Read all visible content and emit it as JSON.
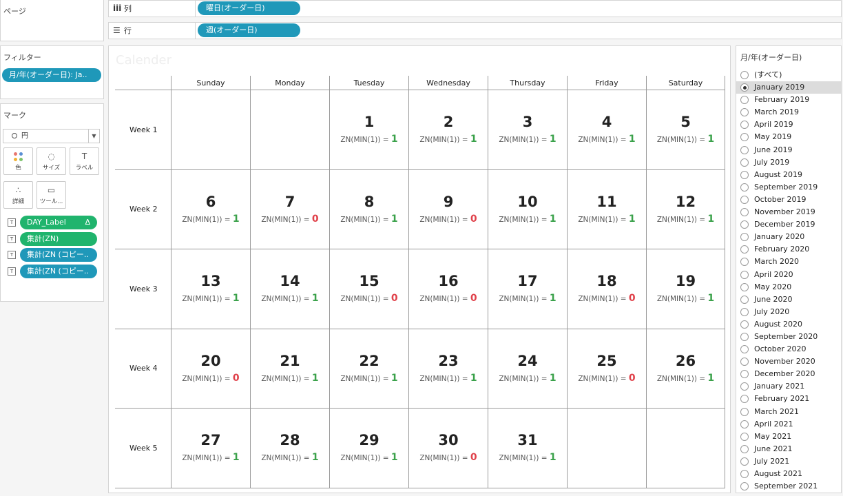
{
  "left": {
    "pages_title": "ページ",
    "filters_title": "フィルター",
    "filter_pill": "月/年(オーダー日): Ja..",
    "marks_title": "マーク",
    "mark_type": "円",
    "mark_buttons": [
      {
        "label": "色",
        "icon": "color-dots-icon"
      },
      {
        "label": "サイズ",
        "icon": "size-icon"
      },
      {
        "label": "ラベル",
        "icon": "label-icon"
      },
      {
        "label": "詳細",
        "icon": "detail-icon"
      },
      {
        "label": "ツール...",
        "icon": "tooltip-icon"
      }
    ],
    "shelf_pills": [
      {
        "label": "DAY_Label",
        "icon_text": "T",
        "color": "#20b46d",
        "suffix": "Δ"
      },
      {
        "label": "集計(ZN)",
        "icon_text": "T",
        "color": "#20b46d",
        "suffix": ""
      },
      {
        "label": "集計(ZN (コピー..",
        "icon_text": "T",
        "color": "#1f98b9",
        "suffix": ""
      },
      {
        "label": "集計(ZN (コピー..",
        "icon_text": "T",
        "color": "#1f98b9",
        "suffix": ""
      }
    ]
  },
  "shelves": {
    "columns_label": "列",
    "columns_pill": "曜日(オーダー日)",
    "rows_label": "行",
    "rows_pill": "週(オーダー日)"
  },
  "sheet": {
    "title": "Calender",
    "days": [
      "Sunday",
      "Monday",
      "Tuesday",
      "Wednesday",
      "Thursday",
      "Friday",
      "Saturday"
    ],
    "weeks": [
      {
        "label": "Week 1",
        "cells": [
          null,
          null,
          {
            "d": "1",
            "v": "1"
          },
          {
            "d": "2",
            "v": "1"
          },
          {
            "d": "3",
            "v": "1"
          },
          {
            "d": "4",
            "v": "1"
          },
          {
            "d": "5",
            "v": "1"
          }
        ]
      },
      {
        "label": "Week 2",
        "cells": [
          {
            "d": "6",
            "v": "1"
          },
          {
            "d": "7",
            "v": "0"
          },
          {
            "d": "8",
            "v": "1"
          },
          {
            "d": "9",
            "v": "0"
          },
          {
            "d": "10",
            "v": "1"
          },
          {
            "d": "11",
            "v": "1"
          },
          {
            "d": "12",
            "v": "1"
          }
        ]
      },
      {
        "label": "Week 3",
        "cells": [
          {
            "d": "13",
            "v": "1"
          },
          {
            "d": "14",
            "v": "1"
          },
          {
            "d": "15",
            "v": "0"
          },
          {
            "d": "16",
            "v": "0"
          },
          {
            "d": "17",
            "v": "1"
          },
          {
            "d": "18",
            "v": "0"
          },
          {
            "d": "19",
            "v": "1"
          }
        ]
      },
      {
        "label": "Week 4",
        "cells": [
          {
            "d": "20",
            "v": "0"
          },
          {
            "d": "21",
            "v": "1"
          },
          {
            "d": "22",
            "v": "1"
          },
          {
            "d": "23",
            "v": "1"
          },
          {
            "d": "24",
            "v": "1"
          },
          {
            "d": "25",
            "v": "0"
          },
          {
            "d": "26",
            "v": "1"
          }
        ]
      },
      {
        "label": "Week 5",
        "cells": [
          {
            "d": "27",
            "v": "1"
          },
          {
            "d": "28",
            "v": "1"
          },
          {
            "d": "29",
            "v": "1"
          },
          {
            "d": "30",
            "v": "0"
          },
          {
            "d": "31",
            "v": "1"
          },
          null,
          null
        ]
      }
    ],
    "zn_prefix": "ZN(MIN(1)) =",
    "value_colors": {
      "1": "#3aa14a",
      "0": "#e0414a"
    }
  },
  "right": {
    "title": "月/年(オーダー日)",
    "selected": "January 2019",
    "options": [
      "(すべて)",
      "January 2019",
      "February 2019",
      "March 2019",
      "April 2019",
      "May 2019",
      "June 2019",
      "July 2019",
      "August 2019",
      "September 2019",
      "October 2019",
      "November 2019",
      "December 2019",
      "January 2020",
      "February 2020",
      "March 2020",
      "April 2020",
      "May 2020",
      "June 2020",
      "July 2020",
      "August 2020",
      "September 2020",
      "October 2020",
      "November 2020",
      "December 2020",
      "January 2021",
      "February 2021",
      "March 2021",
      "April 2021",
      "May 2021",
      "June 2021",
      "July 2021",
      "August 2021",
      "September 2021"
    ]
  }
}
